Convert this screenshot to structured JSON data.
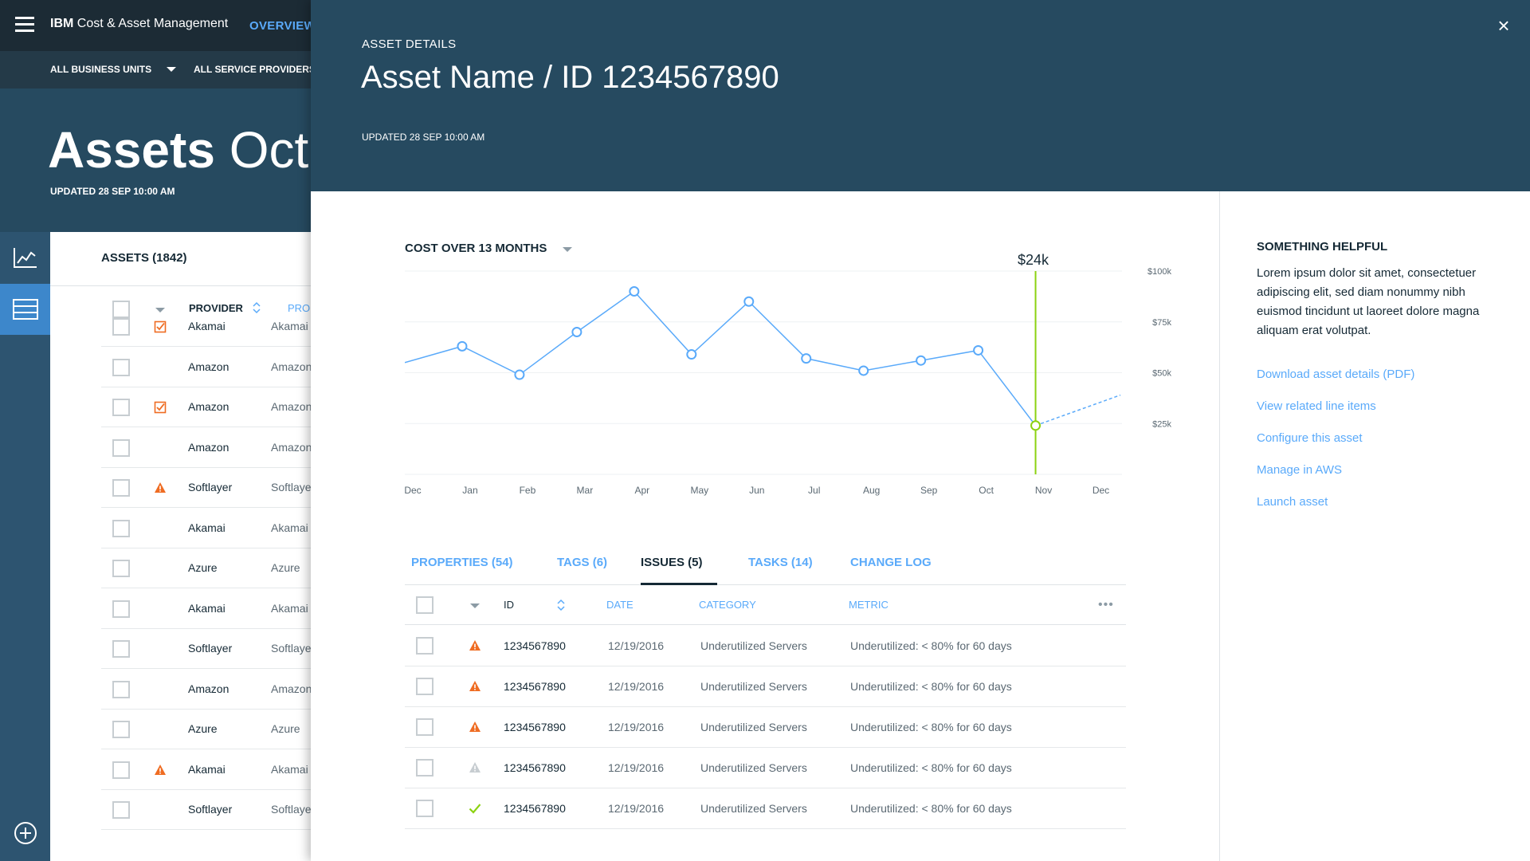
{
  "app": {
    "brand_bold": "IBM",
    "brand_rest": " Cost & Asset Management",
    "nav_overview": "OVERVIEW",
    "filter_business_units": "ALL BUSINESS UNITS",
    "filter_service_providers": "ALL SERVICE PROVIDERS",
    "hero_title_bold": "Assets",
    "hero_title_rest": " Oct",
    "hero_updated": "UPDATED 28 SEP 10:00 AM"
  },
  "asset_list": {
    "title": "ASSETS (1842)",
    "col_provider": "PROVIDER",
    "col_pro": "PRO",
    "rows": [
      {
        "provider": "Akamai",
        "provider2": "Akamai",
        "icon": "checked-orange"
      },
      {
        "provider": "Amazon",
        "provider2": "Amazon",
        "icon": ""
      },
      {
        "provider": "Amazon",
        "provider2": "Amazon",
        "icon": "checked-orange"
      },
      {
        "provider": "Amazon",
        "provider2": "Amazon",
        "icon": ""
      },
      {
        "provider": "Softlayer",
        "provider2": "Softlayer",
        "icon": "warning-orange"
      },
      {
        "provider": "Akamai",
        "provider2": "Akamai",
        "icon": ""
      },
      {
        "provider": "Azure",
        "provider2": "Azure",
        "icon": ""
      },
      {
        "provider": "Akamai",
        "provider2": "Akamai",
        "icon": ""
      },
      {
        "provider": "Softlayer",
        "provider2": "Softlayer",
        "icon": ""
      },
      {
        "provider": "Amazon",
        "provider2": "Amazon",
        "icon": ""
      },
      {
        "provider": "Azure",
        "provider2": "Azure",
        "icon": ""
      },
      {
        "provider": "Akamai",
        "provider2": "Akamai",
        "icon": "warning-orange"
      },
      {
        "provider": "Softlayer",
        "provider2": "Softlayer",
        "icon": ""
      }
    ]
  },
  "detail": {
    "label": "ASSET DETAILS",
    "title": "Asset Name / ID 1234567890",
    "updated": "UPDATED 28 SEP 10:00 AM",
    "close_icon": "close-icon"
  },
  "chart_data": {
    "type": "line",
    "title": "COST OVER 13 MONTHS",
    "highlight_label": "$24k",
    "x": [
      "Dec",
      "Jan",
      "Feb",
      "Mar",
      "Apr",
      "May",
      "Jun",
      "Jul",
      "Aug",
      "Sep",
      "Oct",
      "Nov",
      "Dec"
    ],
    "y_ticks": [
      "$100k",
      "$75k",
      "$50k",
      "$25k"
    ],
    "ylim": [
      0,
      100
    ],
    "series": [
      {
        "values": [
          55,
          63,
          49,
          70,
          90,
          59,
          85,
          57,
          51,
          56,
          61,
          24,
          null
        ]
      }
    ],
    "forecast": {
      "from_index": 11,
      "values": [
        24,
        39
      ]
    },
    "highlight_index": 11,
    "colors": {
      "line": "#5aaafa",
      "highlight": "#8cd211",
      "grid": "#eef1f3"
    }
  },
  "helpful": {
    "title": "SOMETHING HELPFUL",
    "body": "Lorem ipsum dolor sit amet, consectetuer adipiscing elit, sed diam nonummy nibh euismod tincidunt ut laoreet dolore magna aliquam erat volutpat.",
    "links": [
      "Download asset details (PDF)",
      "View related line items",
      "Configure this asset",
      "Manage in AWS",
      "Launch asset"
    ]
  },
  "tabs": [
    {
      "label": "PROPERTIES (54)",
      "active": false
    },
    {
      "label": "TAGS (6)",
      "active": false
    },
    {
      "label": "ISSUES (5)",
      "active": true
    },
    {
      "label": "TASKS (14)",
      "active": false
    },
    {
      "label": "CHANGE LOG",
      "active": false
    }
  ],
  "issues_table": {
    "headers": {
      "id": "ID",
      "date": "DATE",
      "category": "CATEGORY",
      "metric": "METRIC"
    },
    "more_icon": "more-icon",
    "rows": [
      {
        "status": "warning-orange",
        "id": "1234567890",
        "date": "12/19/2016",
        "category": "Underutilized Servers",
        "metric": "Underutilized: < 80% for 60 days"
      },
      {
        "status": "warning-orange",
        "id": "1234567890",
        "date": "12/19/2016",
        "category": "Underutilized Servers",
        "metric": "Underutilized: < 80% for 60 days"
      },
      {
        "status": "warning-orange",
        "id": "1234567890",
        "date": "12/19/2016",
        "category": "Underutilized Servers",
        "metric": "Underutilized: < 80% for 60 days"
      },
      {
        "status": "warning-gray",
        "id": "1234567890",
        "date": "12/19/2016",
        "category": "Underutilized Servers",
        "metric": "Underutilized: < 80% for 60 days"
      },
      {
        "status": "check-green",
        "id": "1234567890",
        "date": "12/19/2016",
        "category": "Underutilized Servers",
        "metric": "Underutilized: < 80% for 60 days"
      }
    ]
  }
}
